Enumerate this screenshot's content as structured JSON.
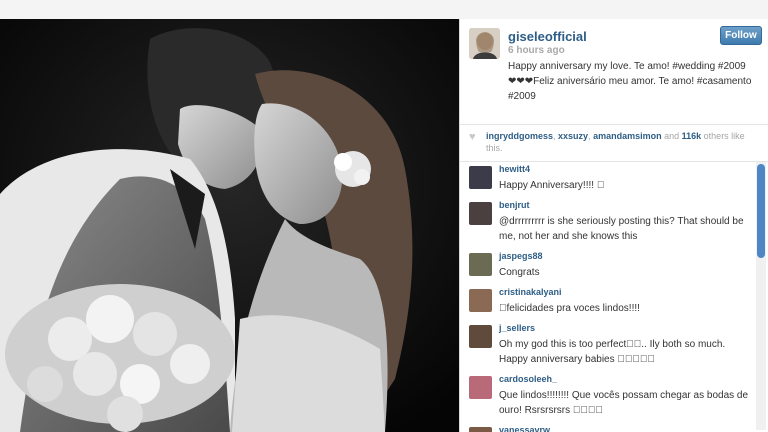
{
  "post": {
    "username": "giseleofficial",
    "time": "6 hours ago",
    "follow_label": "Follow",
    "caption_line1": "Happy anniversary my love. Te amo! #wedding #2009",
    "caption_line2": "❤❤❤Feliz aniversário meu amor. Te amo! #casamento #2009"
  },
  "likes": {
    "user1": "ingryddgomess",
    "sep1": ", ",
    "user2": "xxsuzy",
    "sep2": ", ",
    "user3": "amandamsimon",
    "and_text": " and ",
    "count": "116k",
    "suffix": " others like this."
  },
  "comments": [
    {
      "user": "hewitt4",
      "text": "Happy Anniversary!!!! 󾍀",
      "avatar_color": "#3b3b4a"
    },
    {
      "user": "benjrut",
      "text": "@drrrrrrrrr is she seriously posting this? That should be me, not her and she knows this",
      "avatar_color": "#4a4040"
    },
    {
      "user": "jaspegs88",
      "text": "Congrats",
      "avatar_color": "#6b6a52"
    },
    {
      "user": "cristinakalyani",
      "text": "󾌧felicidades pra voces lindos!!!!",
      "avatar_color": "#8a6a55"
    },
    {
      "user": "j_sellers",
      "text": "Oh my god this is too perfect󾌧󾌧.. Ily both so much. Happy anniversary babies 󾆫󾆫󾆫󾆫󾆫",
      "avatar_color": "#5f4a3c"
    },
    {
      "user": "cardosoleeh_",
      "text": "Que lindos!!!!!!!! Que vocês possam chegar as bodas de ouro! Rsrsrsrsrs 󾌧󾌧󾌧󾌧",
      "avatar_color": "#b86a78"
    },
    {
      "user": "vanessavrw",
      "text": "",
      "avatar_color": "#7a5a44"
    }
  ]
}
